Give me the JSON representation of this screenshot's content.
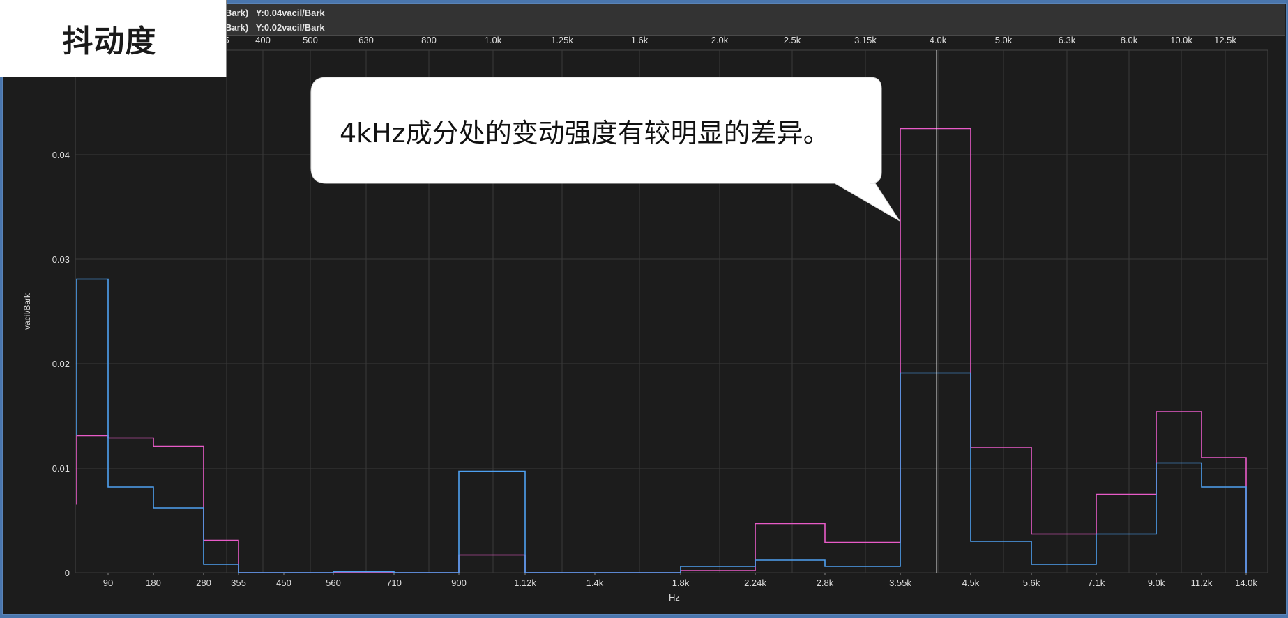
{
  "title": "抖动度",
  "cursor": {
    "line1": "Bark)   Y:0.04vacil/Bark",
    "line2": "Bark)   Y:0.02vacil/Bark"
  },
  "callout": "4kHz成分处的变动强度有较明显的差异。",
  "colors": {
    "background": "#1c1c1c",
    "grid": "#3a3a3a",
    "series_pink": "#e85bc8",
    "series_blue": "#4ea0f0",
    "cursor_line": "#e6e6e6",
    "frame": "#4a76ad"
  },
  "chart_data": {
    "type": "line",
    "style": "step",
    "xlabel": "Hz",
    "ylabel": "vacil/Bark",
    "ylim": [
      0,
      0.05
    ],
    "y_ticks": [
      "0",
      "0.01",
      "0.02",
      "0.03",
      "0.04"
    ],
    "x_ticks_bottom": [
      "90",
      "180",
      "280",
      "355",
      "450",
      "560",
      "710",
      "900",
      "1.12k",
      "1.4k",
      "1.8k",
      "2.24k",
      "2.8k",
      "3.55k",
      "4.5k",
      "5.6k",
      "7.1k",
      "9.0k",
      "11.2k",
      "14.0k"
    ],
    "x_ticks_top": [
      "5",
      "400",
      "500",
      "630",
      "800",
      "1.0k",
      "1.25k",
      "1.6k",
      "2.0k",
      "2.5k",
      "3.15k",
      "4.0k",
      "5.0k",
      "6.3k",
      "8.0k",
      "10.0k",
      "12.5k"
    ],
    "bin_edges": [
      "90",
      "180",
      "280",
      "355",
      "450",
      "560",
      "710",
      "900",
      "1.12k",
      "1.4k",
      "1.8k",
      "2.24k",
      "2.8k",
      "3.55k",
      "4.5k",
      "5.6k",
      "7.1k",
      "9.0k",
      "11.2k",
      "14.0k"
    ],
    "cursor_x": "4.0k",
    "series": [
      {
        "color": "#e85bc8",
        "start_value": 0.0065,
        "values": [
          0.0131,
          0.0129,
          0.0121,
          0.0031,
          0.0,
          0.0,
          0.0,
          0.0,
          0.0017,
          0.0,
          0.0,
          0.0002,
          0.0047,
          0.0029,
          0.0425,
          0.012,
          0.0037,
          0.0075,
          0.0154,
          0.011
        ]
      },
      {
        "color": "#4ea0f0",
        "start_value": 0.0131,
        "values": [
          0.0281,
          0.0082,
          0.0062,
          0.0008,
          0.0,
          0.0,
          0.0001,
          0.0,
          0.0097,
          0.0,
          0.0,
          0.0006,
          0.0012,
          0.0006,
          0.0191,
          0.003,
          0.0008,
          0.0037,
          0.0105,
          0.0082
        ]
      }
    ]
  }
}
